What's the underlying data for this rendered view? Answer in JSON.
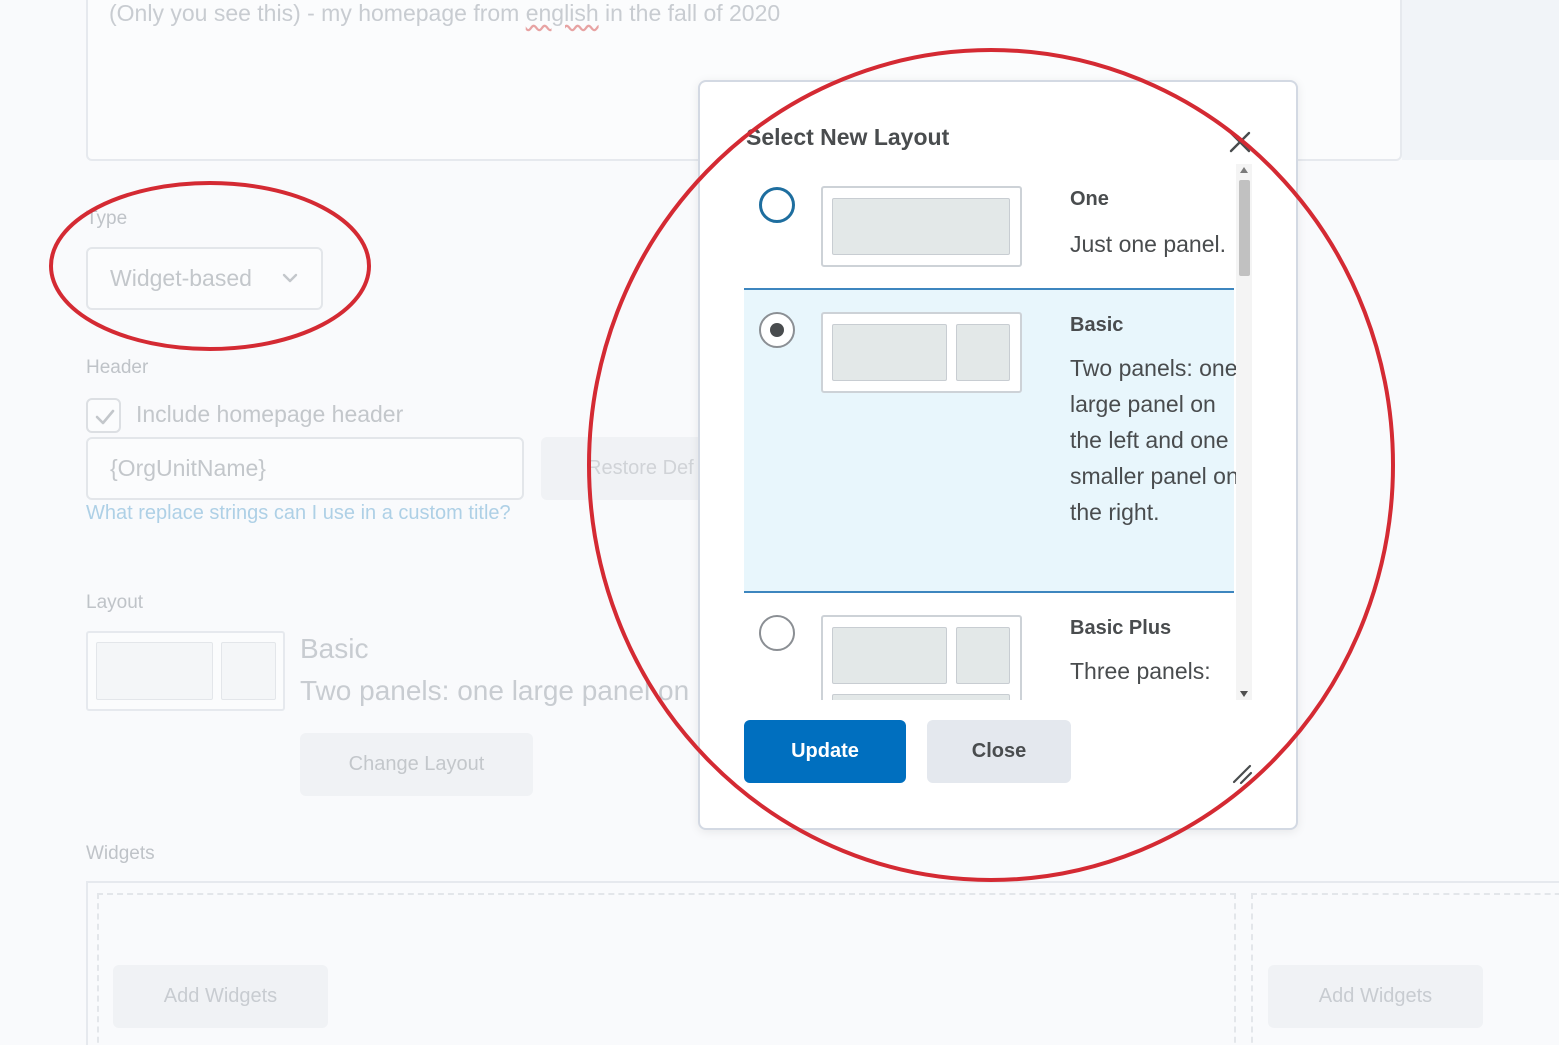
{
  "description": {
    "prefix": "(Only you see this) - my homepage from ",
    "misspelled": "english",
    "suffix": " in the fall of 2020"
  },
  "type_field": {
    "label": "Type",
    "value": "Widget-based"
  },
  "header_field": {
    "label": "Header",
    "checkbox_label": "Include homepage header",
    "checked": true,
    "input_value": "{OrgUnitName}",
    "restore_button": "Restore Def",
    "help_link": "What replace strings can I use in a custom title?"
  },
  "layout_field": {
    "label": "Layout",
    "current_name": "Basic",
    "current_desc": "Two panels: one large panel on",
    "change_button": "Change Layout"
  },
  "widgets_field": {
    "label": "Widgets",
    "add_button_1": "Add Widgets",
    "add_button_2": "Add Widgets"
  },
  "dialog": {
    "title": "Select New Layout",
    "options": [
      {
        "name": "One",
        "description": "Just one panel.",
        "selected": false
      },
      {
        "name": "Basic",
        "description": "Two panels: one large panel on the left and one smaller panel on the right.",
        "selected": true
      },
      {
        "name": "Basic Plus",
        "description": "Three panels:",
        "selected": false
      }
    ],
    "update_button": "Update",
    "close_button": "Close"
  },
  "colors": {
    "primary": "#006fbf",
    "selected_row": "#e8f6fc",
    "annotation": "#d42a33"
  },
  "icons": {
    "close": "close-icon",
    "chevron": "chevron-down-icon",
    "check": "checkmark-icon",
    "resize": "resize-grip-icon"
  }
}
